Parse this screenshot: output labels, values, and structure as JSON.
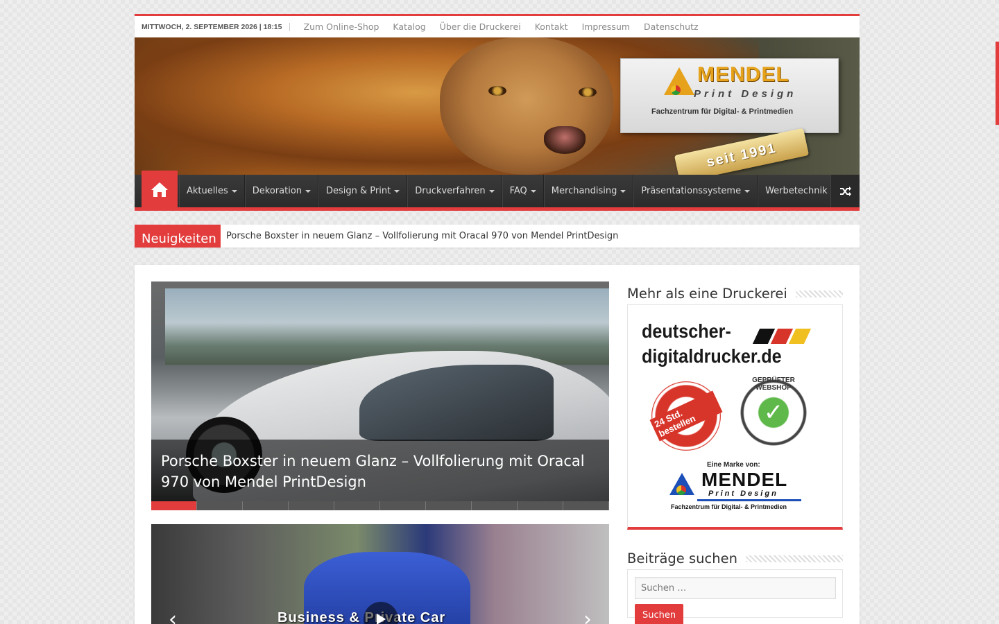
{
  "topbar": {
    "date": "MITTWOCH, 2. SEPTEMBER 2026 | 18:15",
    "links": [
      "Zum Online-Shop",
      "Katalog",
      "Über die Druckerei",
      "Kontakt",
      "Impressum",
      "Datenschutz"
    ]
  },
  "banner": {
    "logo_title": "MENDEL",
    "logo_sub": "Print Design",
    "logo_tagline": "Fachzentrum für Digital- & Printmedien",
    "ribbon": "seit 1991"
  },
  "nav": {
    "items": [
      "Aktuelles",
      "Dekoration",
      "Design & Print",
      "Druckverfahren",
      "FAQ",
      "Merchandising",
      "Präsentationssysteme",
      "Werbetechnik"
    ]
  },
  "breaking": {
    "label": "Neuigkeiten",
    "text": "Porsche Boxster in neuem Glanz – Vollfolierung mit Oracal 970 von Mendel PrintDesign"
  },
  "slider1": {
    "caption": "Porsche Boxster in neuem Glanz – Vollfolierung mit Oracal 970 von Mendel PrintDesign",
    "slide_count": 10,
    "active_index": 0
  },
  "slider2": {
    "title": "Business & Private Car"
  },
  "sidebar": {
    "ad_widget_title": "Mehr als eine Druckerei",
    "ad": {
      "line1": "deutscher-",
      "line2": "digitaldrucker.de",
      "badge_red": "24 Std. bestellen",
      "badge_green": "GEPRÜFTER WEBSHOP",
      "eine_marke": "Eine Marke von:",
      "brand": "MENDEL",
      "brand_sub": "Print Design",
      "brand_tag": "Fachzentrum für Digital- & Printmedien"
    },
    "search_widget_title": "Beiträge suchen",
    "search": {
      "placeholder": "Suchen …",
      "button": "Suchen"
    }
  },
  "colors": {
    "accent": "#e23c3c",
    "nav_bg": "#2b2b2b"
  }
}
